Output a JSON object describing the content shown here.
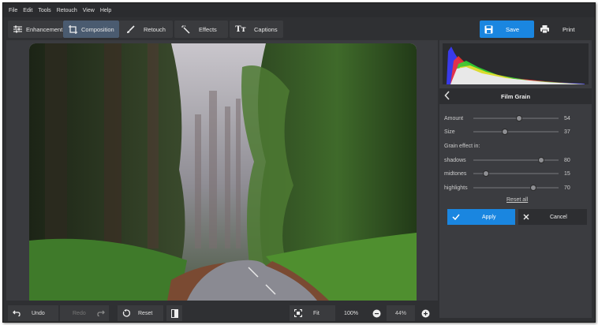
{
  "menu": [
    "File",
    "Edit",
    "Tools",
    "Retouch",
    "View",
    "Help"
  ],
  "tabs": [
    {
      "label": "Enhancement",
      "icon": "sliders-icon"
    },
    {
      "label": "Composition",
      "icon": "crop-icon"
    },
    {
      "label": "Retouch",
      "icon": "brush-icon"
    },
    {
      "label": "Effects",
      "icon": "magic-wand-icon"
    },
    {
      "label": "Captions",
      "icon": "text-icon"
    }
  ],
  "actions": {
    "save": "Save",
    "print": "Print"
  },
  "panel": {
    "title": "Film Grain",
    "amount_label": "Amount",
    "amount": "54",
    "size_label": "Size",
    "size": "37",
    "grain_effect_label": "Grain effect in:",
    "shadows_label": "shadows",
    "shadows": "80",
    "midtones_label": "midtones",
    "midtones": "15",
    "highlights_label": "highlights",
    "highlights": "70",
    "reset_all": "Reset all",
    "apply": "Apply",
    "cancel": "Cancel"
  },
  "slider_levels": {
    "amount": 0.54,
    "size": 0.37,
    "shadows": 0.8,
    "midtones": 0.15,
    "highlights": 0.7
  },
  "bottom": {
    "undo": "Undo",
    "redo": "Redo",
    "reset": "Reset",
    "fit": "Fit",
    "zoom_100": "100%",
    "zoom_value": "44%"
  },
  "colors": {
    "accent": "#1a86e0",
    "active_tab": "#4a5b70",
    "background": "#2f3033"
  }
}
